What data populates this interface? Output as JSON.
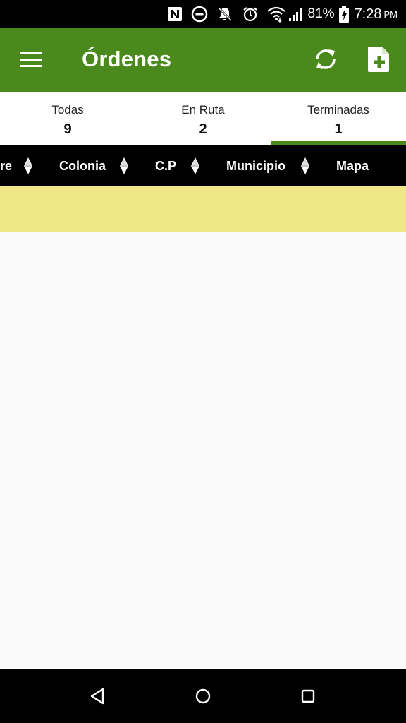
{
  "status_bar": {
    "battery": "81%",
    "time": "7:28",
    "ampm": "PM",
    "icons": [
      "nfc-icon",
      "do-not-disturb-icon",
      "notifications-off-icon",
      "alarm-icon",
      "wifi-icon",
      "signal-icon",
      "battery-charging-icon"
    ]
  },
  "app_bar": {
    "title": "Órdenes",
    "background": "#4a8a1c",
    "icons": [
      "menu-icon",
      "refresh-icon",
      "new-document-icon"
    ]
  },
  "tabs": [
    {
      "label": "Todas",
      "count": "9"
    },
    {
      "label": "En Ruta",
      "count": "2"
    },
    {
      "label": "Terminadas",
      "count": "1",
      "selected": true
    }
  ],
  "table": {
    "columns": [
      "re",
      "Colonia",
      "C.P",
      "Municipio",
      "Mapa"
    ],
    "row_color": "#f0e886"
  },
  "nav_bar": {
    "icons": [
      "back-icon",
      "home-icon",
      "recents-icon"
    ]
  }
}
